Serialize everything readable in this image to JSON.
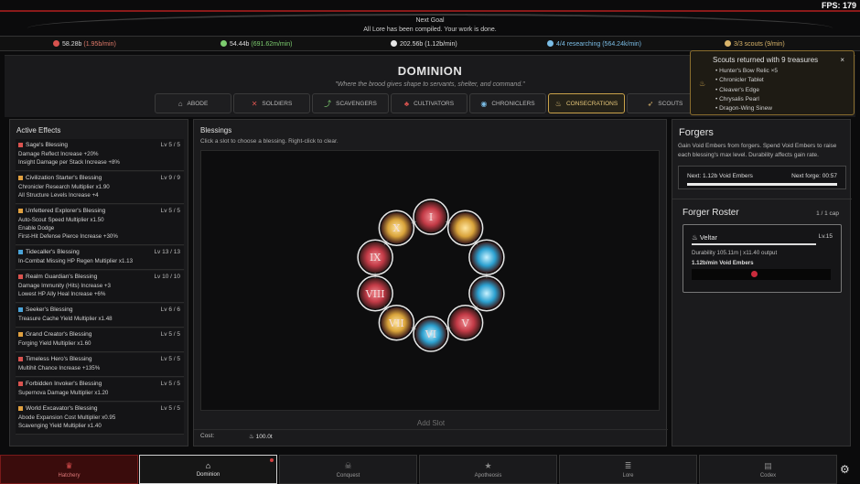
{
  "fps": "FPS: 179",
  "goal": {
    "label": "Next Goal",
    "text": "All Lore has been compiled. Your work is done."
  },
  "resources": [
    {
      "icon": "flame-icon",
      "value": "58.28b",
      "rate": "(1.95b/min)",
      "color": "#e07a6a"
    },
    {
      "icon": "leaf-icon",
      "value": "54.44b",
      "rate": "(691.62m/min)",
      "color": "#7ccc6e"
    },
    {
      "icon": "ember-icon",
      "value": "202.56b",
      "rate": "(1.12b/min)",
      "color": "#dddddd"
    },
    {
      "icon": "eye-icon",
      "value": "4/4 researching",
      "rate": "(564.24k/min)",
      "color": "#7bbde6"
    },
    {
      "icon": "scout-icon",
      "value": "3/3 scouts",
      "rate": "(9/min)",
      "color": "#d9b46a"
    }
  ],
  "header": {
    "title": "DOMINION",
    "subtitle": "\"Where the brood gives shape to servants, shelter, and command.\""
  },
  "tabs": [
    {
      "label": "ABODE",
      "icon": "house-icon",
      "glyph": "⌂"
    },
    {
      "label": "SOLDIERS",
      "icon": "swords-icon",
      "glyph": "✕"
    },
    {
      "label": "SCAVENGERS",
      "icon": "pick-icon",
      "glyph": "⤴"
    },
    {
      "label": "CULTIVATORS",
      "icon": "root-icon",
      "glyph": "♣"
    },
    {
      "label": "CHRONICLERS",
      "icon": "eye-icon",
      "glyph": "◉"
    },
    {
      "label": "CONSECRATIONS",
      "icon": "flame-icon",
      "glyph": "♨"
    },
    {
      "label": "SCOUTS",
      "icon": "scout-icon",
      "glyph": "➶"
    }
  ],
  "toast": {
    "title": "Scouts returned with 9 treasures",
    "close": "×",
    "items": [
      "• Hunter's Bow Relic ×5",
      "• Chronicler Tablet",
      "• Cleaver's Edge",
      "• Chrysalis Pearl",
      "• Dragon-Wing Sinew"
    ]
  },
  "effects": {
    "title": "Active Effects",
    "items": [
      {
        "name": "Sage's Blessing",
        "level": "Lv 5 / 5",
        "color": "#d9534f",
        "lines": [
          "Damage Reflect Increase +20%",
          "Insight Damage per Stack Increase +8%"
        ]
      },
      {
        "name": "Civilization Starter's Blessing",
        "level": "Lv 9 / 9",
        "color": "#e0a040",
        "lines": [
          "Chronicler Research Multiplier x1.90",
          "All Structure Levels Increase +4"
        ]
      },
      {
        "name": "Unfettered Explorer's Blessing",
        "level": "Lv 5 / 5",
        "color": "#e0a040",
        "lines": [
          "Auto-Scout Speed Multiplier x1.50",
          "Enable Dodge",
          "First-Hit Defense Pierce Increase +30%"
        ]
      },
      {
        "name": "Tidecaller's Blessing",
        "level": "Lv 13 / 13",
        "color": "#4aa3d8",
        "lines": [
          "In-Combat Missing HP Regen Multiplier x1.13"
        ]
      },
      {
        "name": "Realm Guardian's Blessing",
        "level": "Lv 10 / 10",
        "color": "#d9534f",
        "lines": [
          "Damage Immunity (Hits) Increase +3",
          "Lowest HP Ally Heal Increase +6%"
        ]
      },
      {
        "name": "Seeker's Blessing",
        "level": "Lv 6 / 6",
        "color": "#4aa3d8",
        "lines": [
          "Treasure Cache Yield Multiplier x1.48"
        ]
      },
      {
        "name": "Grand Creator's Blessing",
        "level": "Lv 5 / 5",
        "color": "#e0a040",
        "lines": [
          "Forging Yield Multiplier x1.60"
        ]
      },
      {
        "name": "Timeless Hero's Blessing",
        "level": "Lv 5 / 5",
        "color": "#d9534f",
        "lines": [
          "Multihit Chance Increase +135%"
        ]
      },
      {
        "name": "Forbidden Invoker's Blessing",
        "level": "Lv 5 / 5",
        "color": "#d9534f",
        "lines": [
          "Supernova Damage Multiplier x1.20"
        ]
      },
      {
        "name": "World Excavator's Blessing",
        "level": "Lv 5 / 5",
        "color": "#e0a040",
        "lines": [
          "Abode Expansion Cost Multiplier x0.95",
          "Scavenging Yield Multiplier x1.40"
        ]
      }
    ]
  },
  "blessings": {
    "title": "Blessings",
    "subtitle": "Click a slot to choose a blessing. Right-click to clear.",
    "slots": [
      {
        "label": "I",
        "type": "red"
      },
      {
        "label": "",
        "type": "gold"
      },
      {
        "label": "",
        "type": "blue"
      },
      {
        "label": "",
        "type": "blue"
      },
      {
        "label": "V",
        "type": "red"
      },
      {
        "label": "VI",
        "type": "blue"
      },
      {
        "label": "VII",
        "type": "gold"
      },
      {
        "label": "VIII",
        "type": "red"
      },
      {
        "label": "IX",
        "type": "red"
      },
      {
        "label": "X",
        "type": "gold"
      }
    ],
    "add_slot": "Add Slot",
    "cost_label": "Cost:",
    "cost_value": "100.0t",
    "colors": {
      "red": "#c23a46",
      "gold": "#d9a33a",
      "blue": "#2ba0d0"
    }
  },
  "forgers": {
    "title": "Forgers",
    "description": "Gain Void Embers from forgers. Spend Void Embers to raise each blessing's max level. Durability affects gain rate.",
    "next_label": "Next: 1.12b Void Embers",
    "next_forge": "Next forge: 00:57",
    "roster_title": "Forger Roster",
    "roster_cap": "1 / 1 cap",
    "forger": {
      "name": "Veltar",
      "level": "Lv.15",
      "durability": "Durability 105.11m  |  x11.40 output",
      "rate": "1.12b/min Void Embers"
    }
  },
  "nav": [
    {
      "label": "Hatchery",
      "icon": "crown-icon",
      "glyph": "♛"
    },
    {
      "label": "Dominion",
      "icon": "house-icon",
      "glyph": "⌂"
    },
    {
      "label": "Conquest",
      "icon": "skull-icon",
      "glyph": "☠"
    },
    {
      "label": "Apotheosis",
      "icon": "star-icon",
      "glyph": "★"
    },
    {
      "label": "Lore",
      "icon": "scroll-icon",
      "glyph": "≣"
    },
    {
      "label": "Codex",
      "icon": "book-icon",
      "glyph": "▤"
    }
  ]
}
